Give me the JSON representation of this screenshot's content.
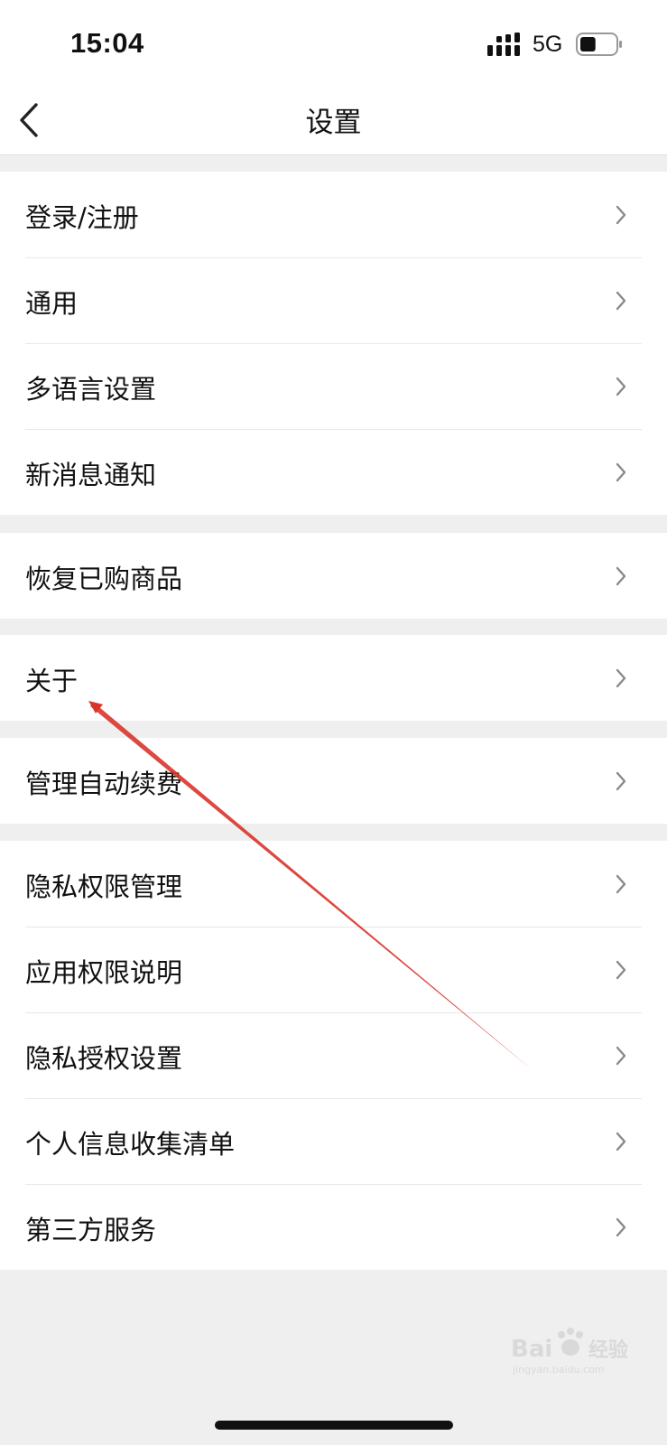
{
  "status_bar": {
    "time": "15:04",
    "network": "5G",
    "battery_level": 0.45
  },
  "nav": {
    "title": "设置",
    "back_icon": "chevron-left-icon"
  },
  "groups": [
    {
      "items": [
        {
          "label": "登录/注册"
        },
        {
          "label": "通用"
        },
        {
          "label": "多语言设置"
        },
        {
          "label": "新消息通知"
        }
      ]
    },
    {
      "items": [
        {
          "label": "恢复已购商品"
        }
      ]
    },
    {
      "items": [
        {
          "label": "关于"
        }
      ]
    },
    {
      "items": [
        {
          "label": "管理自动续费"
        }
      ]
    },
    {
      "items": [
        {
          "label": "隐私权限管理"
        },
        {
          "label": "应用权限说明"
        },
        {
          "label": "隐私授权设置"
        },
        {
          "label": "个人信息收集清单"
        },
        {
          "label": "第三方服务"
        }
      ]
    }
  ],
  "icons": {
    "row_chevron": "chevron-right-icon",
    "annotation": "red-arrow-annotation",
    "watermark": "baidu-jingyan-watermark-logo"
  },
  "colors": {
    "background": "#efefef",
    "surface": "#ffffff",
    "text": "#111111",
    "chevron": "#8a8a8a",
    "annotation": "#d9342b"
  },
  "watermark_text": "Baidu经验 jingyan.baidu.com"
}
